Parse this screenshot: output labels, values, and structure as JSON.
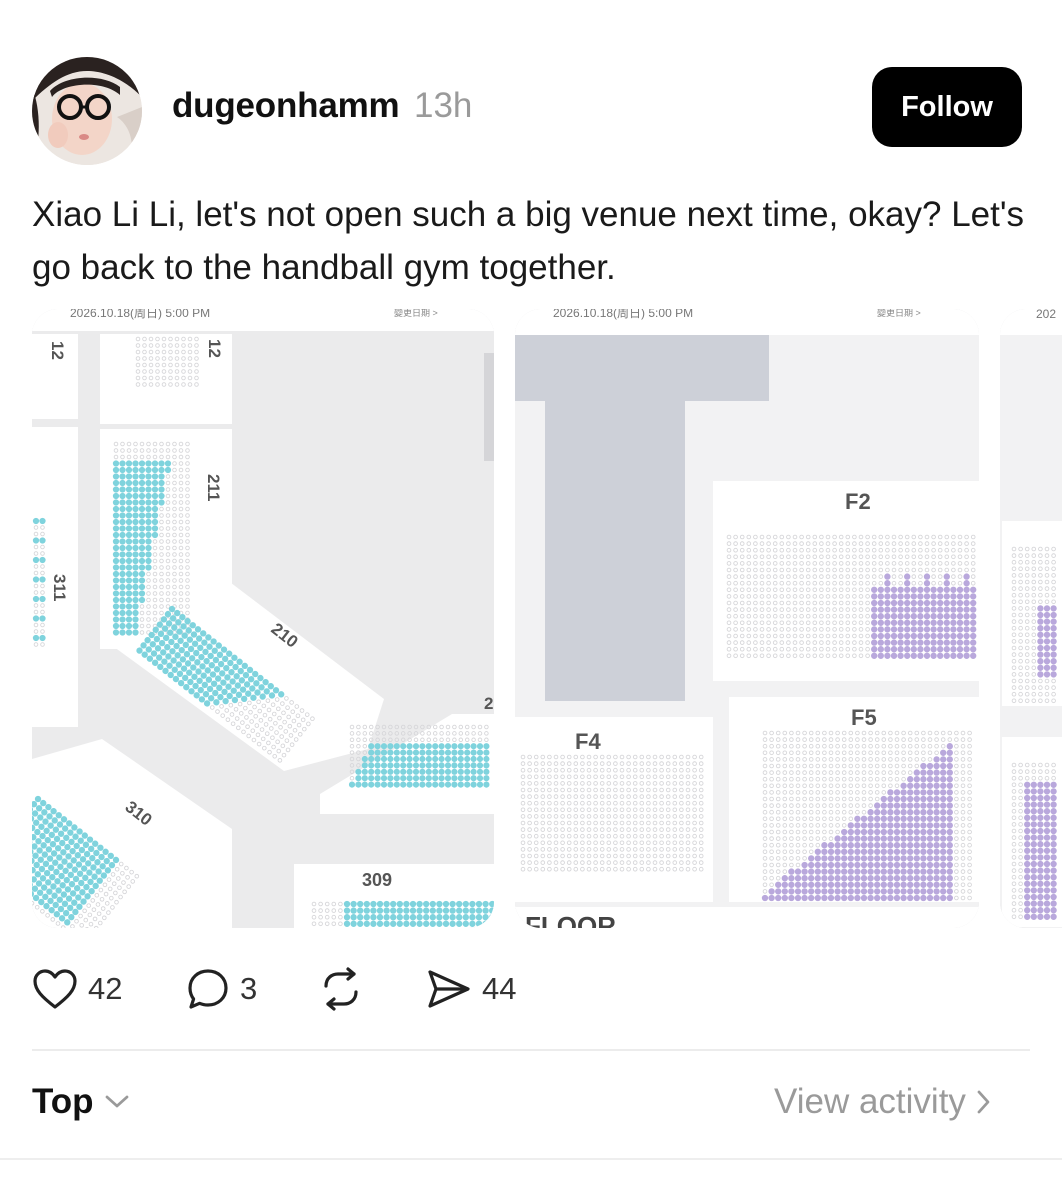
{
  "post": {
    "username": "dugeonhamm",
    "timestamp": "13h",
    "follow_label": "Follow",
    "text": "Xiao Li Li, let's not open such a big venue next time, okay? Let's go back to the handball gym together."
  },
  "images": [
    {
      "header_left": "2026.10.18(周日) 5:00 PM",
      "header_right": "變更日期 >",
      "sections": [
        "12",
        "12",
        "211",
        "311",
        "210",
        "2",
        "310",
        "309"
      ],
      "seat_color": "#7fd3dd"
    },
    {
      "header_left": "2026.10.18(周日) 5:00 PM",
      "header_right": "變更日期 >",
      "sections": [
        "F2",
        "F4",
        "F5",
        "FLOOR"
      ],
      "seat_color": "#b9a8dc"
    },
    {
      "header_left": "202"
    }
  ],
  "actions": {
    "likes": "42",
    "replies": "3",
    "shares": "44"
  },
  "footer": {
    "sort_label": "Top",
    "view_activity_label": "View activity"
  }
}
